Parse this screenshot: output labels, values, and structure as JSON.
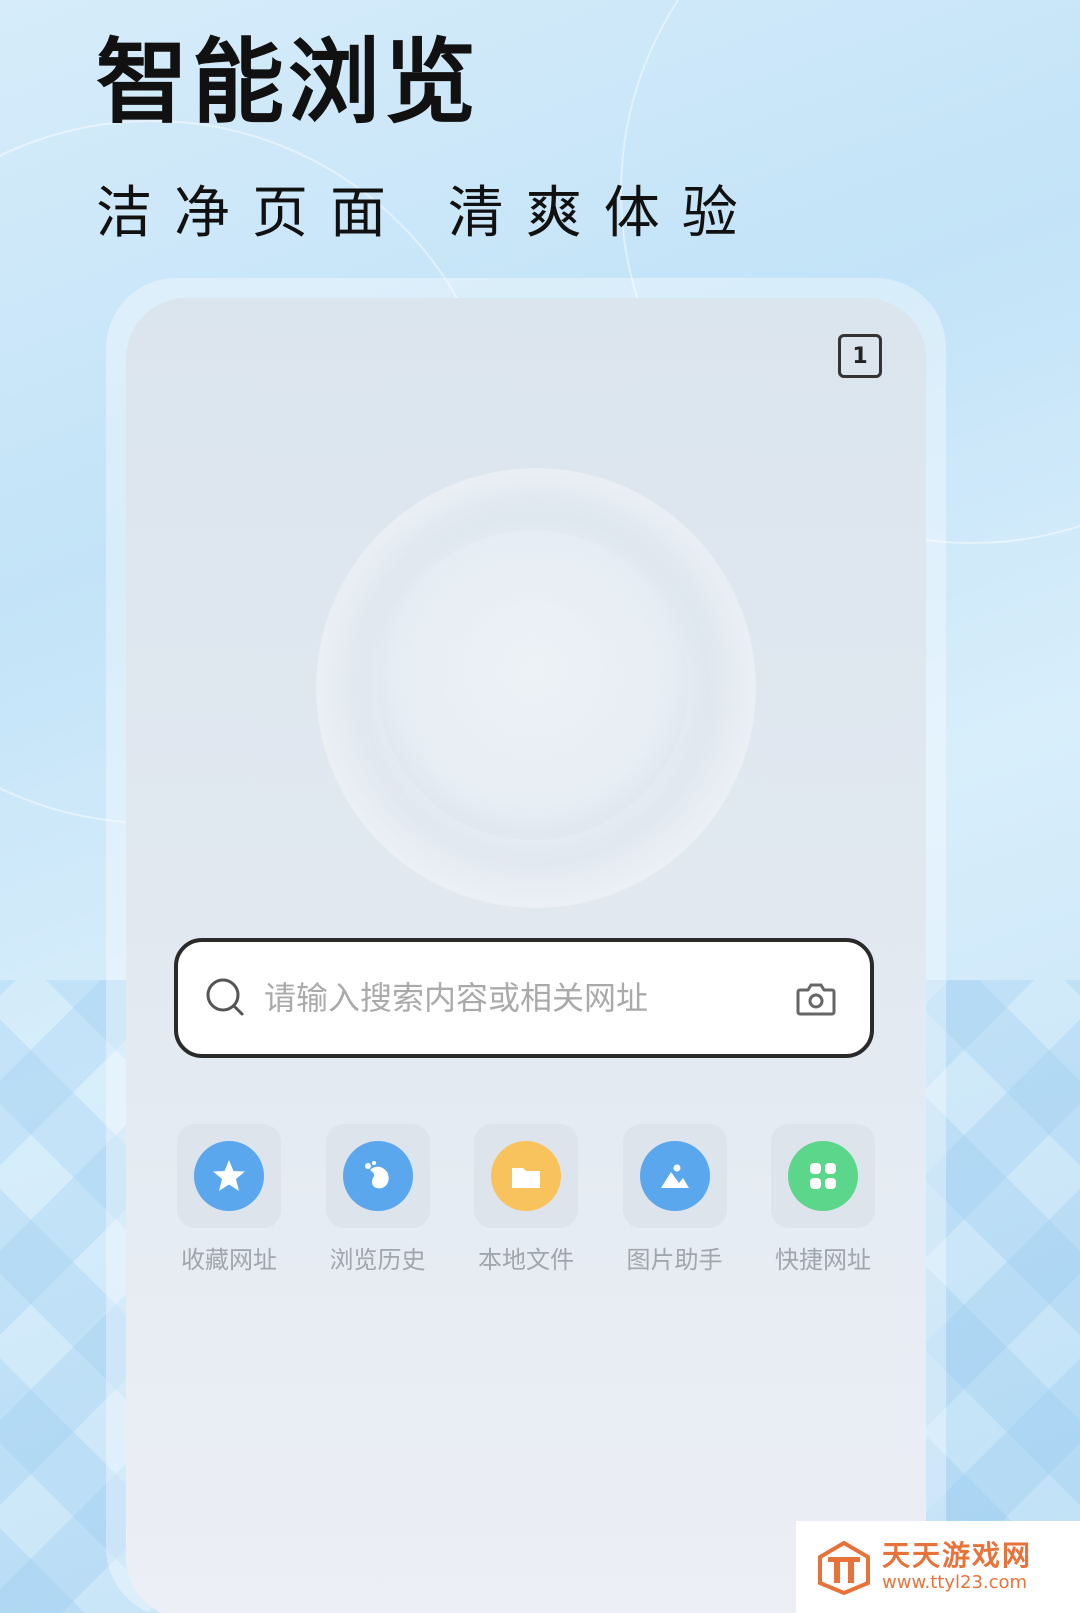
{
  "hero": {
    "title": "智能浏览",
    "subtitle": "洁净页面  清爽体验"
  },
  "browser": {
    "tab_count": "1",
    "search": {
      "placeholder": "请输入搜索内容或相关网址",
      "value": ""
    },
    "shortcuts": [
      {
        "label": "收藏网址",
        "icon": "star-icon",
        "color": "#5aa7ee"
      },
      {
        "label": "浏览历史",
        "icon": "history-icon",
        "color": "#5aa7ee"
      },
      {
        "label": "本地文件",
        "icon": "folder-icon",
        "color": "#f8c25c"
      },
      {
        "label": "图片助手",
        "icon": "image-icon",
        "color": "#5aa7ee"
      },
      {
        "label": "快捷网址",
        "icon": "clover-icon",
        "color": "#5bd68b"
      }
    ]
  },
  "watermark": {
    "name": "天天游戏网",
    "url": "www.ttyl23.com",
    "color": "#e8733a"
  }
}
